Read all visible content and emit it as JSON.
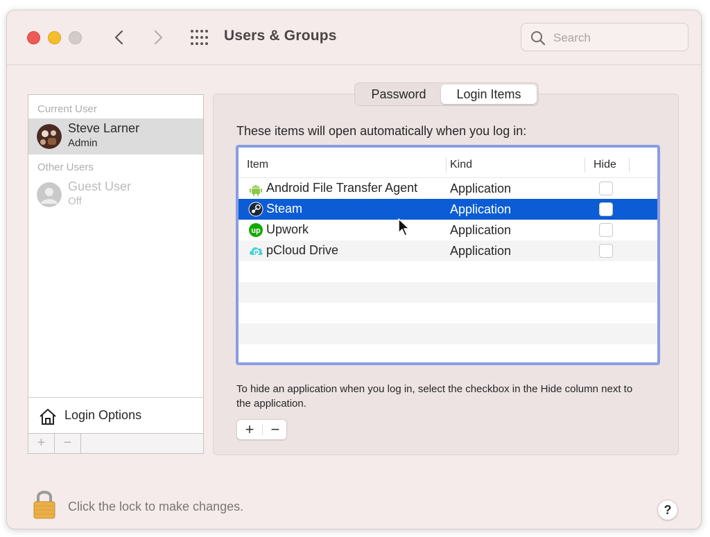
{
  "window": {
    "title": "Users & Groups",
    "search_placeholder": "Search"
  },
  "sidebar": {
    "current_user_label": "Current User",
    "current_user": {
      "name": "Steve Larner",
      "role": "Admin"
    },
    "other_users_label": "Other Users",
    "guest_user": {
      "name": "Guest User",
      "status": "Off"
    },
    "login_options_label": "Login Options",
    "add_label": "+",
    "remove_label": "−"
  },
  "tabs": [
    {
      "label": "Password",
      "selected": false
    },
    {
      "label": "Login Items",
      "selected": true
    }
  ],
  "login_items": {
    "intro": "These items will open automatically when you log in:",
    "columns": [
      "Item",
      "Kind",
      "Hide"
    ],
    "rows": [
      {
        "item": "Android File Transfer Agent",
        "kind": "Application",
        "hide": false,
        "icon": "android-icon",
        "selected": false
      },
      {
        "item": "Steam",
        "kind": "Application",
        "hide": false,
        "icon": "steam-icon",
        "selected": true
      },
      {
        "item": "Upwork",
        "kind": "Application",
        "hide": false,
        "icon": "upwork-icon",
        "selected": false
      },
      {
        "item": "pCloud Drive",
        "kind": "Application",
        "hide": false,
        "icon": "pcloud-icon",
        "selected": false
      }
    ],
    "hint": "To hide an application when you log in, select the checkbox in the Hide column next to the application.",
    "add_label": "+",
    "remove_label": "−"
  },
  "footer": {
    "lock_text": "Click the lock to make changes.",
    "help_label": "?"
  },
  "colors": {
    "selection": "#0b5cd5",
    "focus_ring": "#8a9de3",
    "window_bg": "#f4ebea"
  }
}
